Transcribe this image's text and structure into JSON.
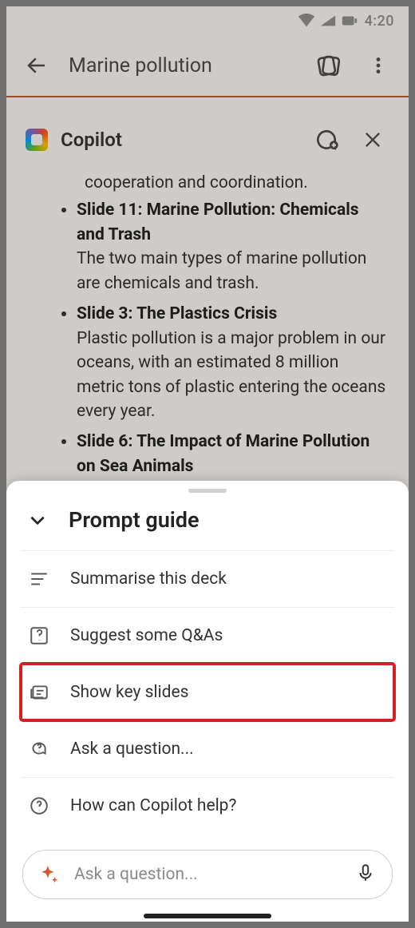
{
  "status": {
    "time": "4:20"
  },
  "header": {
    "title": "Marine pollution"
  },
  "copilot": {
    "title": "Copilot",
    "partial_top_line": "cooperation and coordination.",
    "slides": [
      {
        "title": "Slide 11: Marine Pollution: Chemicals and Trash",
        "desc": "The two main types of marine pollution are chemicals and trash."
      },
      {
        "title": "Slide 3: The Plastics Crisis",
        "desc": "Plastic pollution is a major problem in our oceans, with an estimated 8 million metric tons of plastic entering the oceans every year."
      },
      {
        "title": "Slide 6: The Impact of Marine Pollution on Sea Animals",
        "desc": ""
      }
    ]
  },
  "sheet": {
    "title": "Prompt guide",
    "items": [
      {
        "label": "Summarise this deck"
      },
      {
        "label": "Suggest some Q&As"
      },
      {
        "label": "Show key slides"
      },
      {
        "label": "Ask a question..."
      },
      {
        "label": "How can Copilot help?"
      }
    ]
  },
  "input": {
    "placeholder": "Ask a question..."
  }
}
